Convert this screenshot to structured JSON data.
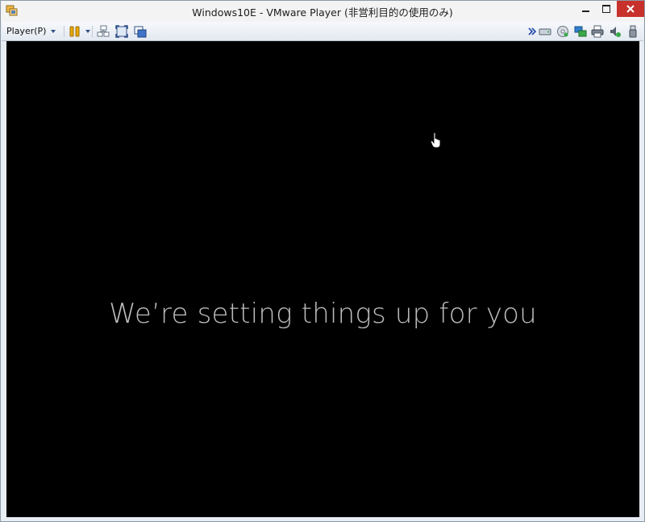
{
  "window": {
    "title": "Windows10E - VMware Player (非営利目的の使用のみ)"
  },
  "toolbar": {
    "player_menu_label": "Player(P)",
    "left_icons": [
      "pause-icon",
      "send-ctrl-alt-del-icon",
      "full-screen-icon",
      "unity-icon"
    ],
    "right_icons": [
      "more-chevron-icon",
      "hard-disk-icon",
      "cd-dvd-icon",
      "network-adapter-icon",
      "printer-icon",
      "sound-card-icon",
      "usb-device-icon"
    ]
  },
  "vm": {
    "message": "We’re setting things up for you",
    "background": "#000000"
  },
  "colors": {
    "close_button": "#c7302b",
    "toolbar_accent": "#2f4f86",
    "pause_icon": "#e8a800"
  }
}
